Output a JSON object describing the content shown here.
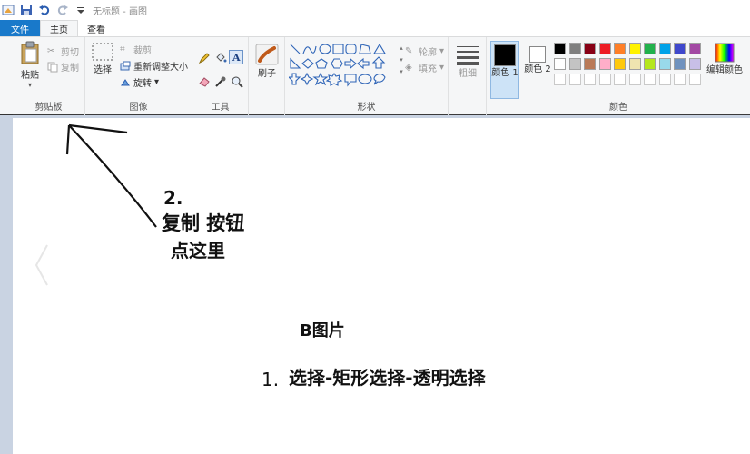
{
  "window": {
    "title": "无标题 - 画图"
  },
  "tabs": {
    "file": "文件",
    "home": "主页",
    "view": "查看"
  },
  "clipboard": {
    "paste": "粘贴",
    "cut": "剪切",
    "copy": "复制",
    "group": "剪贴板"
  },
  "image": {
    "select": "选择",
    "crop": "裁剪",
    "resize": "重新调整大小",
    "rotate": "旋转",
    "group": "图像"
  },
  "tools": {
    "group": "工具"
  },
  "brush": {
    "label": "刷子"
  },
  "shapes": {
    "outline": "轮廓",
    "fill": "填充",
    "group": "形状"
  },
  "size": {
    "label": "粗细"
  },
  "colors": {
    "color1": "颜色 1",
    "color2": "颜色 2",
    "edit": "编辑颜色",
    "group": "颜色",
    "color1_value": "#000000",
    "color2_value": "#ffffff",
    "row1": [
      "#000000",
      "#7f7f7f",
      "#880015",
      "#ed1c24",
      "#ff7f27",
      "#fff200",
      "#22b14c",
      "#00a2e8",
      "#3f48cc",
      "#a349a4"
    ],
    "row2": [
      "#ffffff",
      "#c3c3c3",
      "#b97a57",
      "#ffaec9",
      "#ffc90e",
      "#efe4b0",
      "#b5e61d",
      "#99d9ea",
      "#7092be",
      "#c8bfe7"
    ]
  },
  "annotations": {
    "step2_number": "2.",
    "step2_line1": "复制 按钮",
    "step2_line2": "点这里",
    "image_b": "B图片",
    "step1_number": "1.",
    "step1_text": "选择-矩形选择-透明选择"
  }
}
